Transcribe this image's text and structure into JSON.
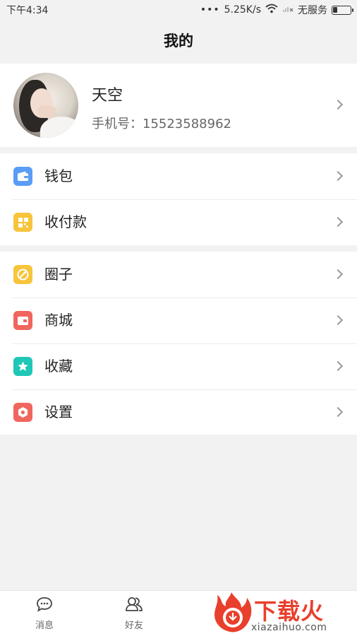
{
  "status_bar": {
    "time": "下午4:34",
    "dots": "•••",
    "speed": "5.25K/s",
    "carrier": "无服务"
  },
  "header": {
    "title": "我的"
  },
  "profile": {
    "name": "天空",
    "phone": "手机号：15523588962"
  },
  "menu_group_1": [
    {
      "label": "钱包",
      "icon": "wallet-icon",
      "color": "#5b9cf6"
    },
    {
      "label": "收付款",
      "icon": "payment-icon",
      "color": "#f7c43b"
    }
  ],
  "menu_group_2": [
    {
      "label": "圈子",
      "icon": "circle-icon",
      "color": "#f7c43b"
    },
    {
      "label": "商城",
      "icon": "mall-icon",
      "color": "#f0665e"
    },
    {
      "label": "收藏",
      "icon": "favorite-star-icon",
      "color": "#1fc7b6"
    },
    {
      "label": "设置",
      "icon": "settings-icon",
      "color": "#f0665e"
    }
  ],
  "bottom_nav": [
    {
      "label": "消息",
      "icon": "message-icon"
    },
    {
      "label": "好友",
      "icon": "friends-icon"
    }
  ],
  "watermark": {
    "brand": "下载火",
    "domain": "xiazaihuo.com"
  }
}
